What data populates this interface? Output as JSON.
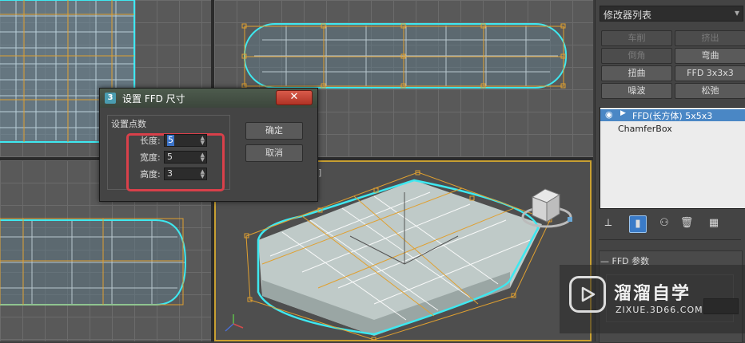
{
  "modifier_panel": {
    "modifier_list_label": "修改器列表",
    "buttons": [
      {
        "label": "车削",
        "enabled": false
      },
      {
        "label": "挤出",
        "enabled": false
      },
      {
        "label": "倒角",
        "enabled": false
      },
      {
        "label": "弯曲",
        "enabled": true
      },
      {
        "label": "扭曲",
        "enabled": true
      },
      {
        "label": "FFD 3x3x3",
        "enabled": true
      },
      {
        "label": "噪波",
        "enabled": true
      },
      {
        "label": "松弛",
        "enabled": true
      }
    ],
    "stack": [
      {
        "label": "FFD(长方体) 5x5x3",
        "selected": true
      },
      {
        "label": "ChamferBox",
        "selected": false
      }
    ],
    "rollout_title": "FFD 参数",
    "toolbar_icons": [
      "pin-stack-icon",
      "show-end-result-icon",
      "make-unique-icon",
      "remove-modifier-icon",
      "configure-sets-icon"
    ]
  },
  "dialog": {
    "icon_text": "3",
    "title": "设置 FFD 尺寸",
    "close_label": "✕",
    "group_label": "设置点数",
    "fields": [
      {
        "label": "长度:",
        "value": "5"
      },
      {
        "label": "宽度:",
        "value": "5"
      },
      {
        "label": "高度:",
        "value": "3"
      }
    ],
    "ok_label": "确定",
    "cancel_label": "取消"
  },
  "viewport": {
    "bracket_text": "]"
  },
  "watermark": {
    "title": "溜溜自学",
    "url": "ZIXUE.3D66.COM"
  },
  "colors": {
    "viewport_bg": "#595959",
    "lattice": "#e0a030",
    "mesh_edge": "#3ee8f0",
    "selection_highlight": "#d9404a",
    "stack_selected": "#4a87c5"
  }
}
